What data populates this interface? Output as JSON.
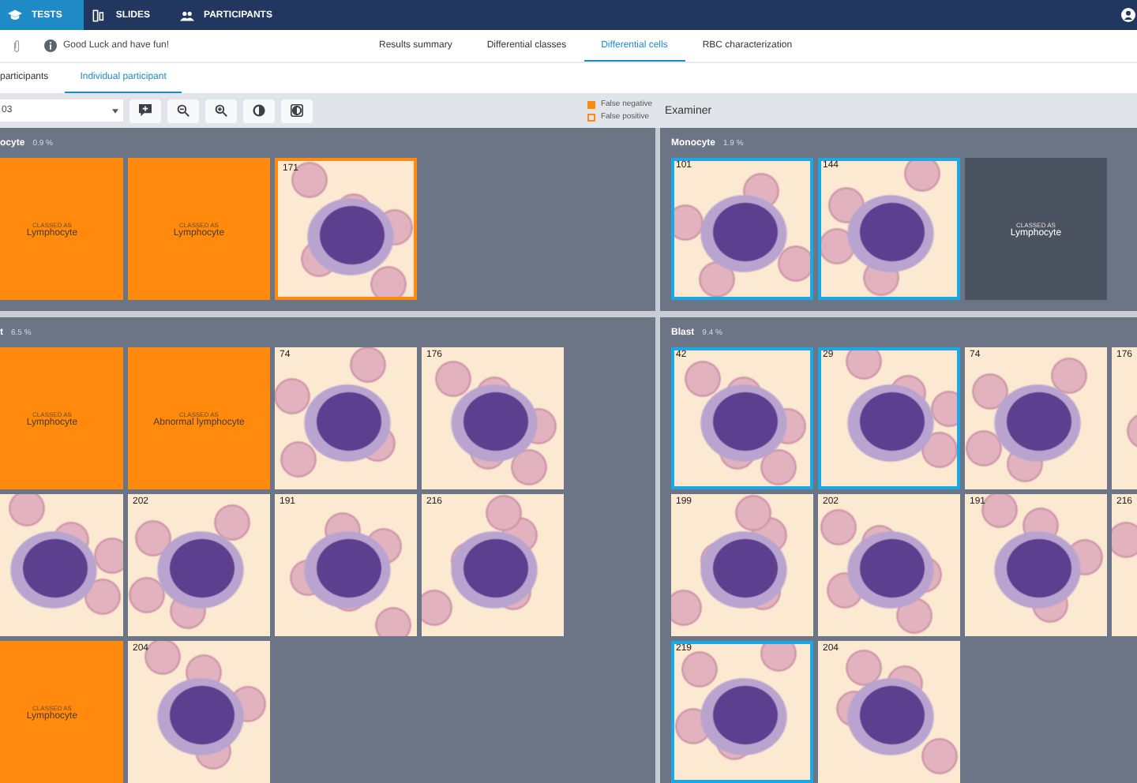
{
  "nav": {
    "tabs": [
      {
        "label": "TESTS",
        "selected": true
      },
      {
        "label": "SLIDES",
        "selected": false
      },
      {
        "label": "PARTICIPANTS",
        "selected": false
      }
    ]
  },
  "header": {
    "notice": "Good Luck and have fun!",
    "tabs": [
      {
        "label": "Results summary",
        "selected": false
      },
      {
        "label": "Differential classes",
        "selected": false
      },
      {
        "label": "Differential cells",
        "selected": true
      },
      {
        "label": "RBC characterization",
        "selected": false
      }
    ]
  },
  "subtabs": [
    {
      "label": "participants",
      "selected": false
    },
    {
      "label": "Individual participant",
      "selected": true
    }
  ],
  "toolbar": {
    "participant": "03"
  },
  "legend": [
    {
      "label": "False negative",
      "kind": "filled"
    },
    {
      "label": "False positive",
      "kind": "outlined"
    }
  ],
  "columns": [
    {
      "groups": [
        {
          "name": "ocyte",
          "percent": "0.9 %",
          "cells": [
            {
              "kind": "classed",
              "caption": "CLASSED AS",
              "label": "Lymphocyte",
              "false_negative": true
            },
            {
              "kind": "classed",
              "caption": "CLASSED AS",
              "label": "Lymphocyte",
              "false_negative": true
            },
            {
              "kind": "photo",
              "number": "171",
              "false_positive": true,
              "selected": false
            }
          ]
        },
        {
          "name": "t",
          "percent": "6.5 %",
          "cells": [
            {
              "kind": "classed",
              "caption": "CLASSED AS",
              "label": "Lymphocyte",
              "false_negative": true
            },
            {
              "kind": "classed",
              "caption": "CLASSED AS",
              "label": "Abnormal lymphocyte",
              "false_negative": true
            },
            {
              "kind": "photo",
              "number": "74",
              "false_positive": false,
              "selected": false
            },
            {
              "kind": "photo",
              "number": "176",
              "false_positive": false,
              "selected": false
            },
            {
              "kind": "photo",
              "false_positive": false,
              "selected": false
            },
            {
              "kind": "photo",
              "number": "202",
              "false_positive": false,
              "selected": false
            },
            {
              "kind": "photo",
              "number": "191",
              "false_positive": false,
              "selected": false
            },
            {
              "kind": "photo",
              "number": "216",
              "false_positive": false,
              "selected": false
            },
            {
              "kind": "classed",
              "caption": "CLASSED AS",
              "label": "Lymphocyte",
              "false_negative": true
            },
            {
              "kind": "photo",
              "number": "204",
              "false_positive": false,
              "selected": false
            }
          ]
        }
      ]
    },
    {
      "heading": "Examiner",
      "groups": [
        {
          "name": "Monocyte",
          "percent": "1.9 %",
          "cells": [
            {
              "kind": "photo",
              "number": "101",
              "false_positive": false,
              "selected": true
            },
            {
              "kind": "photo",
              "number": "144",
              "false_positive": false,
              "selected": true
            },
            {
              "kind": "classed",
              "caption": "CLASSED AS",
              "label": "Lymphocyte",
              "false_negative": false
            }
          ]
        },
        {
          "name": "Blast",
          "percent": "9.4 %",
          "cells": [
            {
              "kind": "photo",
              "number": "42",
              "false_positive": false,
              "selected": true
            },
            {
              "kind": "photo",
              "number": "29",
              "false_positive": false,
              "selected": true
            },
            {
              "kind": "photo",
              "number": "74",
              "false_positive": false,
              "selected": false
            },
            {
              "kind": "photo",
              "number": "176",
              "false_positive": false,
              "selected": false
            },
            {
              "kind": "photo",
              "number": "199",
              "false_positive": false,
              "selected": false
            },
            {
              "kind": "photo",
              "number": "202",
              "false_positive": false,
              "selected": false
            },
            {
              "kind": "photo",
              "number": "191",
              "false_positive": false,
              "selected": false
            },
            {
              "kind": "photo",
              "number": "216",
              "false_positive": false,
              "selected": false
            },
            {
              "kind": "photo",
              "number": "219",
              "false_positive": false,
              "selected": true
            },
            {
              "kind": "photo",
              "number": "204",
              "false_positive": false,
              "selected": false
            }
          ]
        }
      ]
    }
  ]
}
